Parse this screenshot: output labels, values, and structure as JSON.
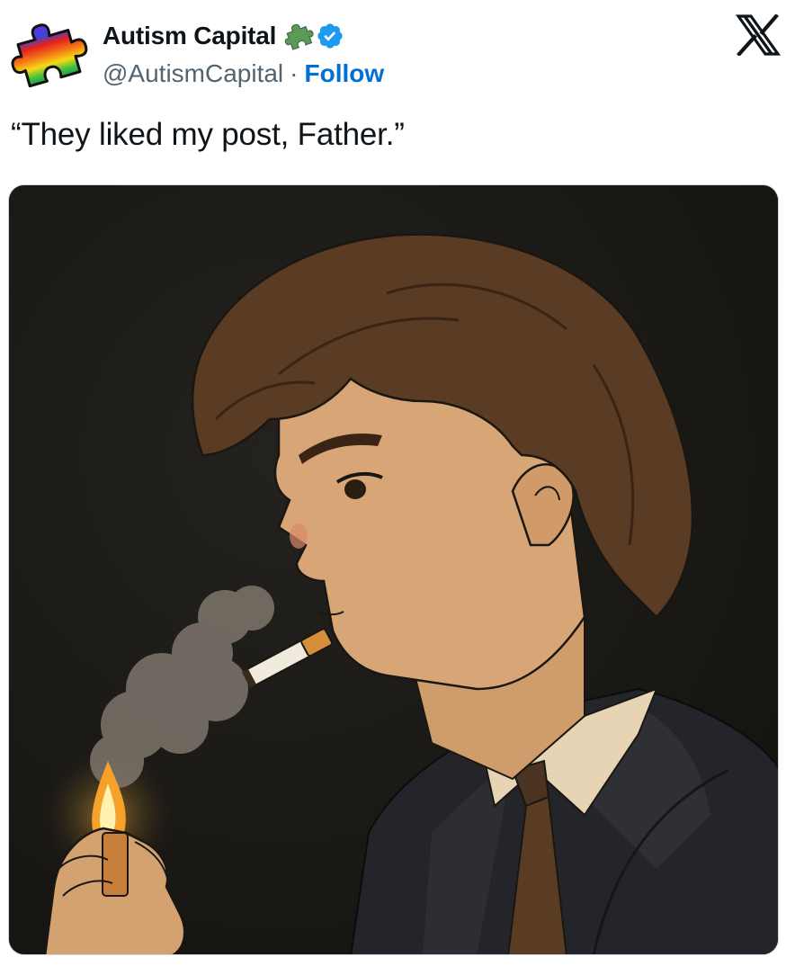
{
  "author": {
    "display_name": "Autism Capital",
    "handle": "@AutismCapital",
    "separator": "·",
    "follow_label": "Follow",
    "avatar_icon": "rainbow-puzzle-piece-icon",
    "badges": [
      "puzzle-piece-icon",
      "verified-badge-icon"
    ]
  },
  "header": {
    "logo_icon": "x-logo-icon"
  },
  "tweet": {
    "text": "“They liked my post, Father.”"
  },
  "media": {
    "icon": "illustration-man-lighting-cigarette"
  },
  "colors": {
    "link": "#006fd6",
    "verified": "#1d9bf0",
    "secondary_text": "#536471",
    "primary_text": "#0f1419",
    "media_border": "#cfd9de",
    "puzzle_green": "#5c9a5a"
  }
}
